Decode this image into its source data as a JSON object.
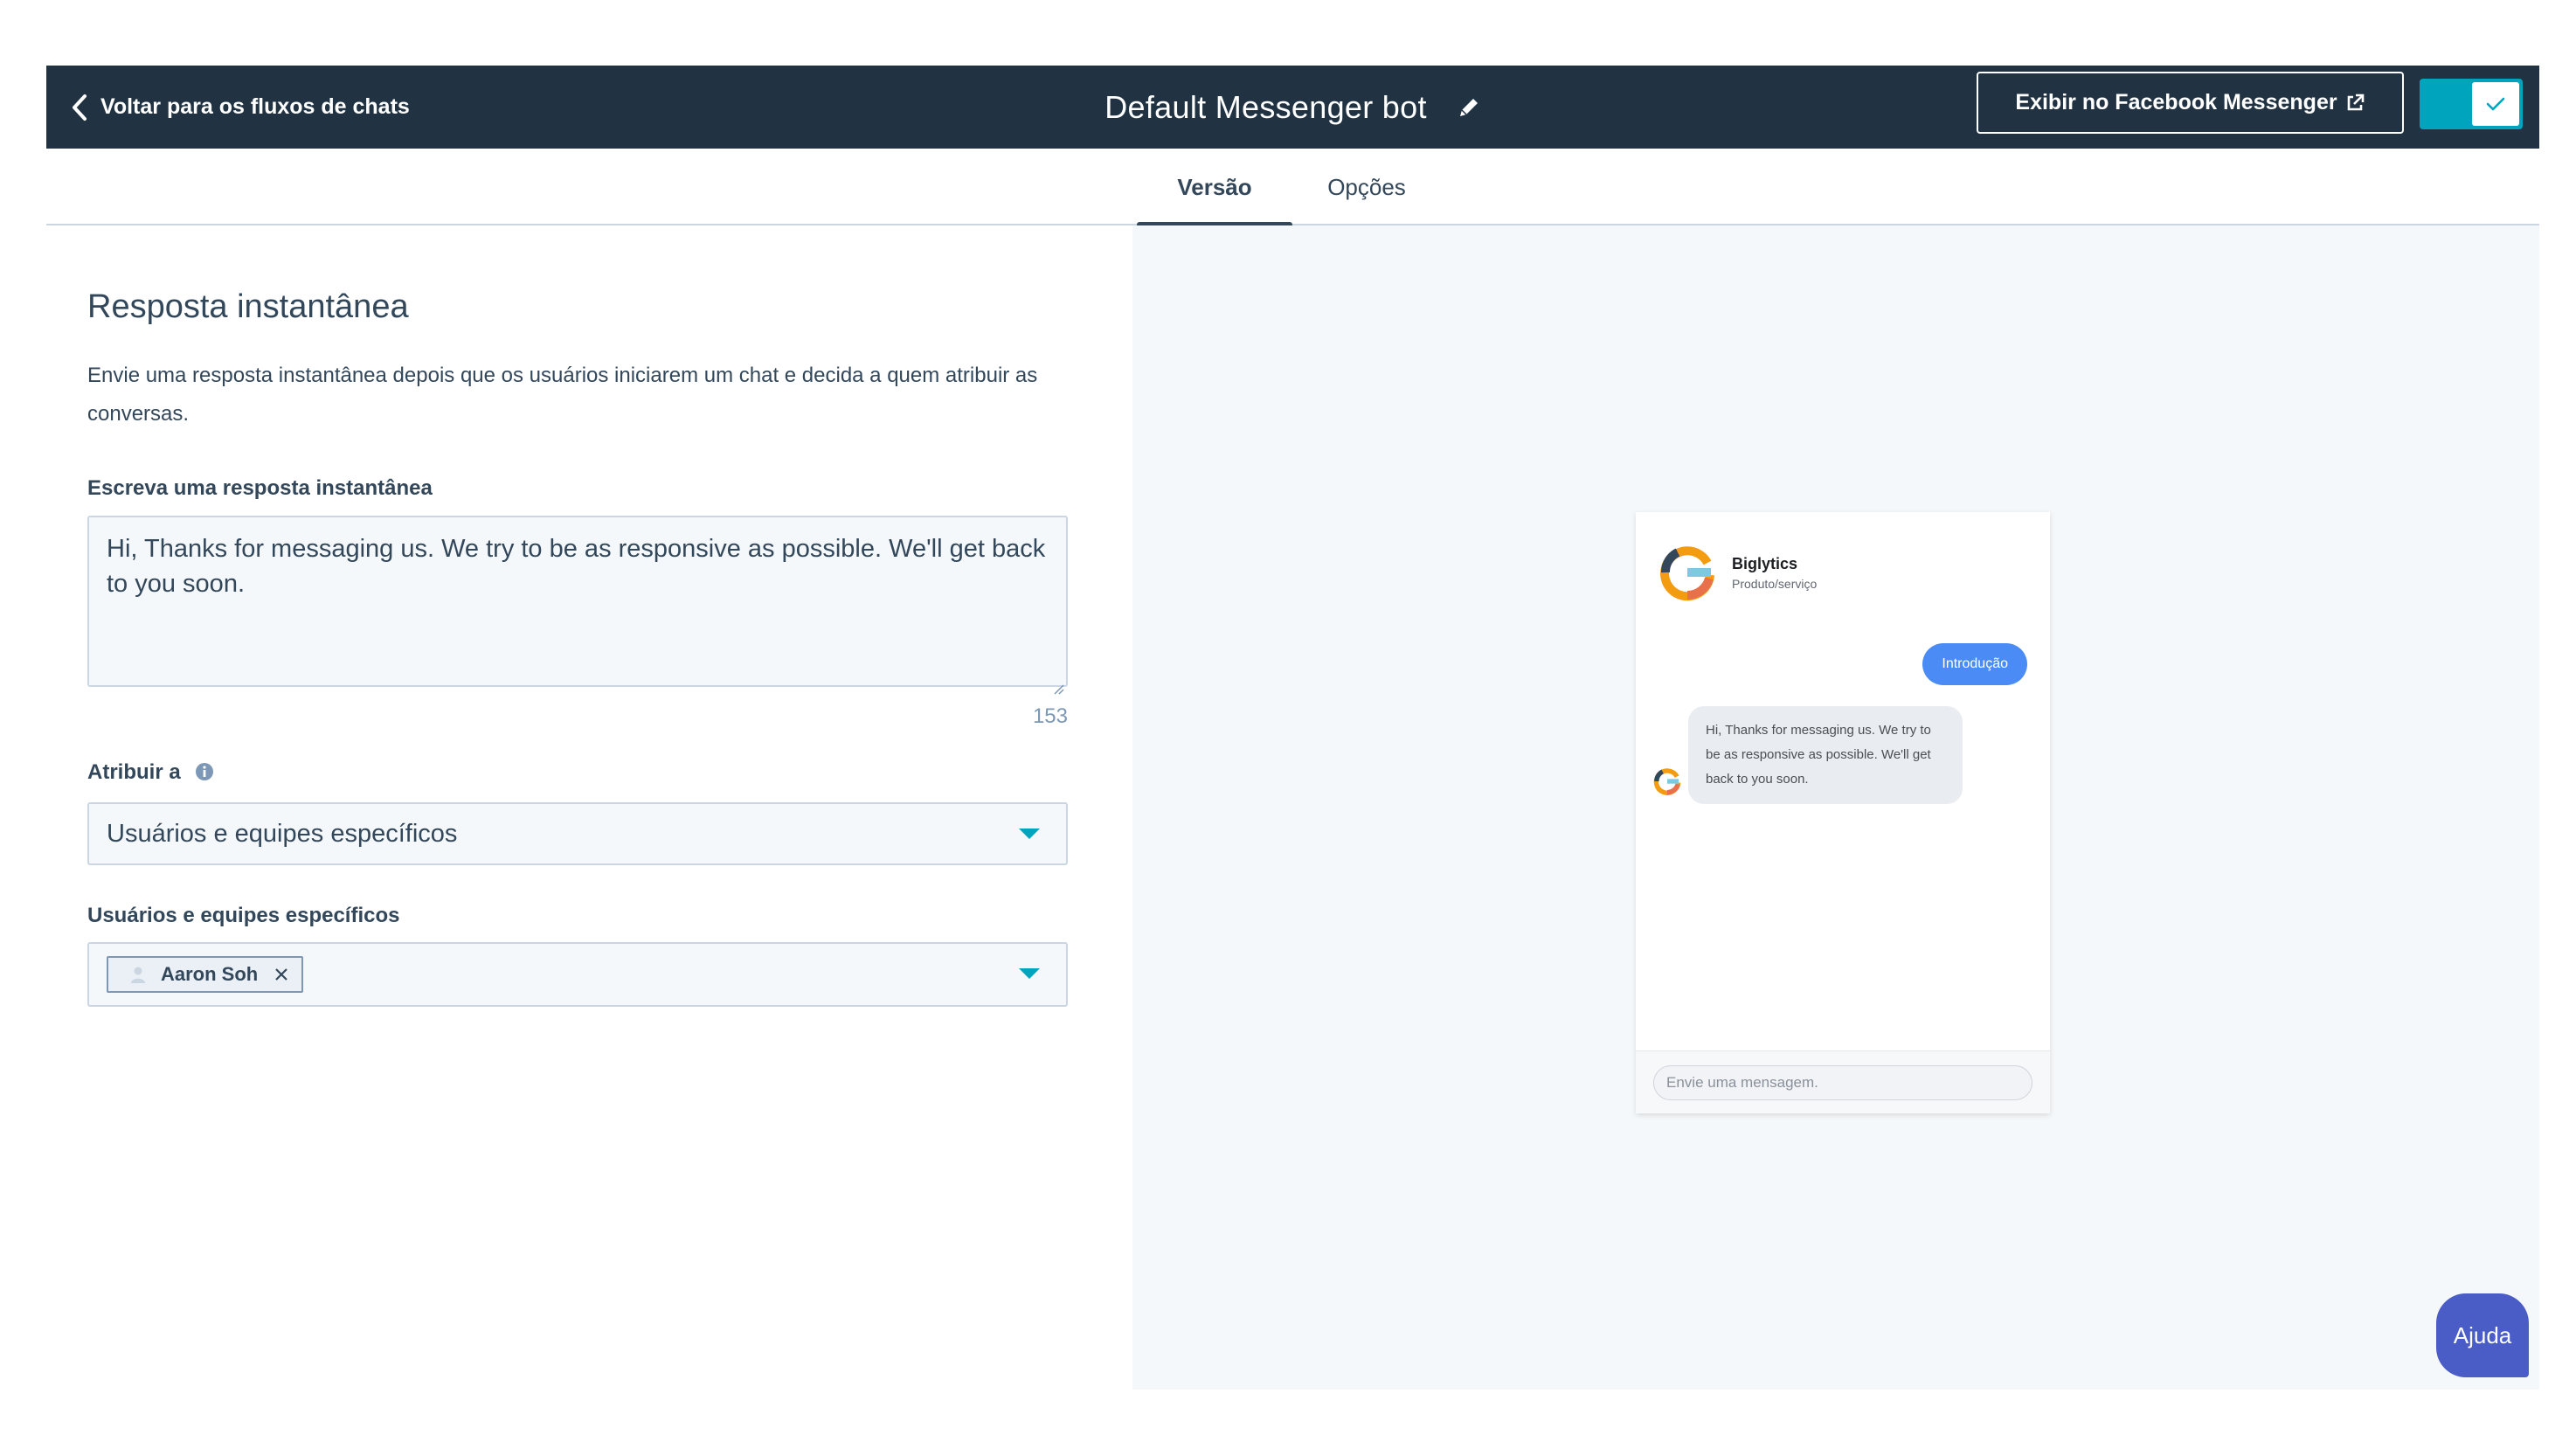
{
  "header": {
    "back_label": "Voltar para os fluxos de chats",
    "title": "Default Messenger bot",
    "fb_button_label": "Exibir no Facebook Messenger",
    "toggle_on": true
  },
  "tabs": [
    {
      "label": "Versão",
      "active": true
    },
    {
      "label": "Opções",
      "active": false
    }
  ],
  "form": {
    "section_title": "Resposta instantânea",
    "section_description": "Envie uma resposta instantânea depois que os usuários iniciarem um chat e decida a quem atribuir as conversas.",
    "reply_label": "Escreva uma resposta instantânea",
    "reply_value": "Hi,  Thanks for messaging us. We try to be as responsive as possible. We'll get back to you soon.",
    "char_count": "153",
    "assign_label": "Atribuir a",
    "assign_value": "Usuários e equipes específicos",
    "specific_label": "Usuários e equipes específicos",
    "selected_user": "Aaron Soh"
  },
  "preview": {
    "page_name": "Biglytics",
    "page_category": "Produto/serviço",
    "outgoing_message": "Introdução",
    "incoming_message": "Hi, Thanks for messaging us. We try to be as responsive as possible. We'll get back to you soon.",
    "compose_placeholder": "Envie uma mensagem."
  },
  "help_label": "Ajuda",
  "colors": {
    "topbar": "#213343",
    "accent": "#00a4bd",
    "messenger_blue": "#4a8bf5",
    "help_button": "#4a5cc6"
  }
}
